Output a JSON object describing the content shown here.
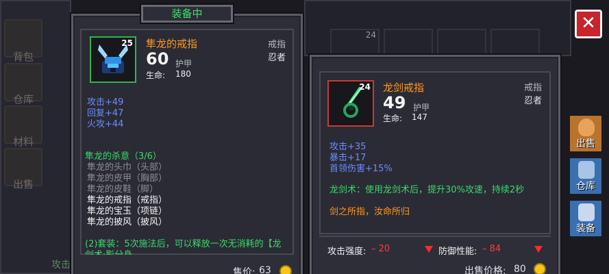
{
  "header": {
    "title": "装备中"
  },
  "left_card": {
    "icon": "viking-helmet-ring-icon",
    "level": "25",
    "name": "隼龙的戒指",
    "type_tag": "戒指",
    "class_tag": "忍者",
    "armor_value": "60",
    "armor_label": "护甲",
    "hp_label": "生命:",
    "hp_value": "180",
    "stats": [
      "攻击+49",
      "回复+47",
      "火攻+44"
    ],
    "set_title": "隼龙的杀意（3/6）",
    "set_items": [
      {
        "text": "隼龙的头巾（头部）",
        "owned": false
      },
      {
        "text": "隼龙的皮甲（胸部）",
        "owned": false
      },
      {
        "text": "隼龙的皮鞋（脚）",
        "owned": false
      },
      {
        "text": "隼龙的戒指（戒指）",
        "owned": true
      },
      {
        "text": "隼龙的宝玉（项链）",
        "owned": true
      },
      {
        "text": "隼龙的披风（披风）",
        "owned": true
      }
    ],
    "set_bonus": "(2)套装：5次施法后，可以释放一次无消耗的【龙",
    "set_bonus_cut": "剑术·影分身",
    "price_label": "售价:",
    "price_value": "63"
  },
  "right_card": {
    "icon": "dragon-sword-ring-icon",
    "level": "24",
    "name": "龙剑戒指",
    "type_tag": "戒指",
    "class_tag": "忍者",
    "armor_value": "49",
    "armor_label": "护甲",
    "hp_label": "生命:",
    "hp_value": "147",
    "stats": [
      "攻击+35",
      "暴击+17",
      "首领伤害+15%"
    ],
    "skill": "龙剑术：使用龙剑术后，提升30%攻速，持续2秒",
    "flavor": "剑之所指，汝命所归",
    "compare": {
      "attack_label": "攻击强度:",
      "attack_value": "– 20",
      "defense_label": "防御性能:",
      "defense_value": "– 84"
    },
    "price_label": "出售价格:",
    "price_value": "80"
  },
  "side_menu": {
    "items": [
      "背包",
      "仓库",
      "材料",
      "出售"
    ]
  },
  "actions": {
    "sell": "出售",
    "warehouse": "仓库",
    "equip": "装备"
  },
  "bg_slot_level": "24",
  "bg_bottom_text": "攻击",
  "colors": {
    "accent_green": "#38d96a",
    "item_orange": "#ff9a1c",
    "stat_blue": "#6a8cff",
    "warning_red": "#ff3b3b",
    "close_red": "#c9232b"
  }
}
